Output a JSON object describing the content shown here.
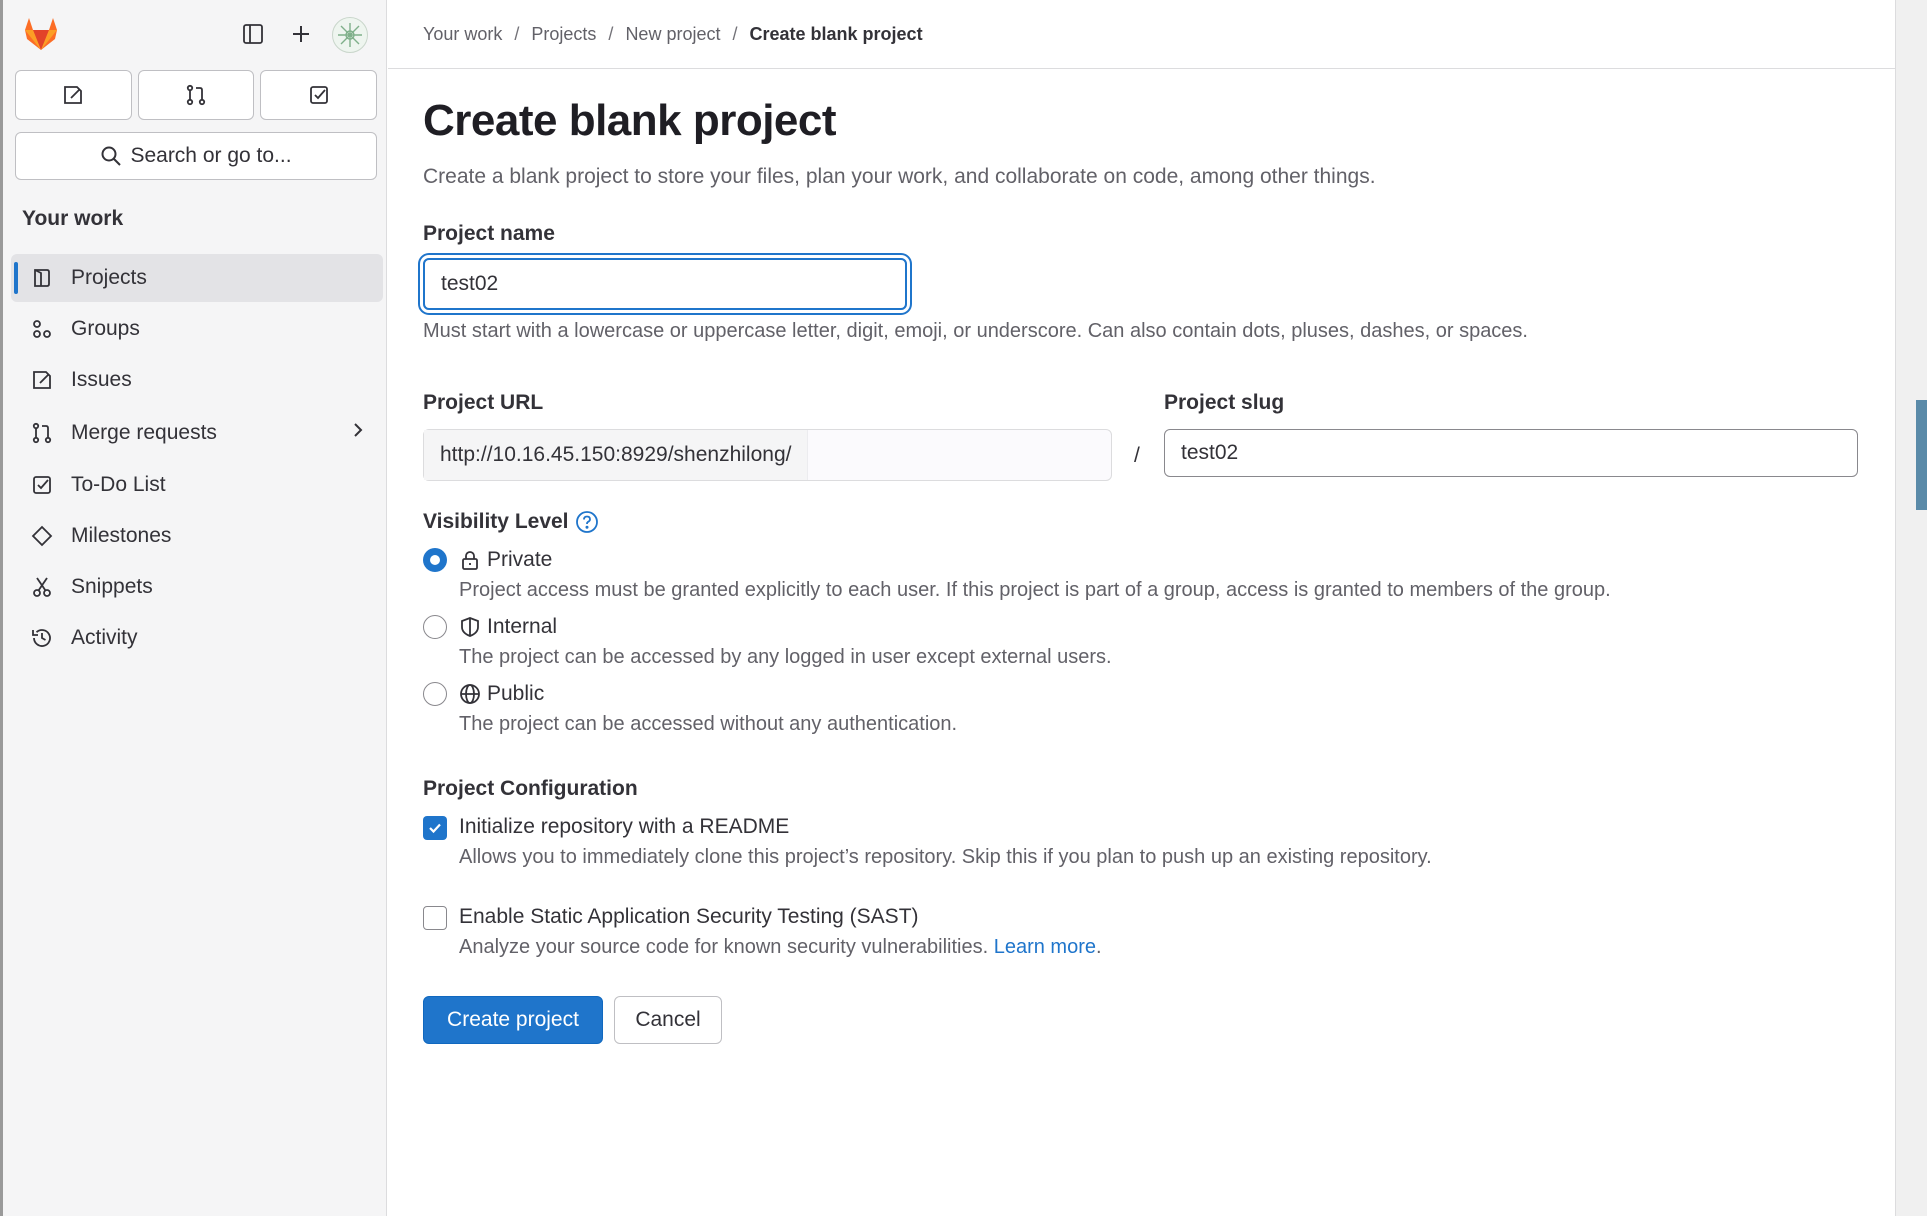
{
  "sidebar": {
    "search_label": "Search or go to...",
    "section_title": "Your work",
    "items": [
      {
        "label": "Projects",
        "icon": "project-icon"
      },
      {
        "label": "Groups",
        "icon": "group-icon"
      },
      {
        "label": "Issues",
        "icon": "issues-icon"
      },
      {
        "label": "Merge requests",
        "icon": "merge-request-icon"
      },
      {
        "label": "To-Do List",
        "icon": "todo-icon"
      },
      {
        "label": "Milestones",
        "icon": "milestone-icon"
      },
      {
        "label": "Snippets",
        "icon": "snippet-icon"
      },
      {
        "label": "Activity",
        "icon": "history-icon"
      }
    ]
  },
  "breadcrumb": [
    "Your work",
    "Projects",
    "New project",
    "Create blank project"
  ],
  "page": {
    "title": "Create blank project",
    "description": "Create a blank project to store your files, plan your work, and collaborate on code, among other things."
  },
  "form": {
    "project_name": {
      "label": "Project name",
      "value": "test02",
      "help": "Must start with a lowercase or uppercase letter, digit, emoji, or underscore. Can also contain dots, pluses, dashes, or spaces."
    },
    "project_url": {
      "label": "Project URL",
      "value": "http://10.16.45.150:8929/shenzhilong/"
    },
    "url_separator": "/",
    "project_slug": {
      "label": "Project slug",
      "value": "test02"
    },
    "visibility": {
      "label": "Visibility Level",
      "selected": "Private",
      "options": [
        {
          "title": "Private",
          "icon": "lock-icon",
          "description": "Project access must be granted explicitly to each user. If this project is part of a group, access is granted to members of the group."
        },
        {
          "title": "Internal",
          "icon": "shield-icon",
          "description": "The project can be accessed by any logged in user except external users."
        },
        {
          "title": "Public",
          "icon": "globe-icon",
          "description": "The project can be accessed without any authentication."
        }
      ]
    },
    "configuration": {
      "label": "Project Configuration",
      "readme": {
        "title": "Initialize repository with a README",
        "description": "Allows you to immediately clone this project’s repository. Skip this if you plan to push up an existing repository.",
        "checked": true
      },
      "sast": {
        "title": "Enable Static Application Security Testing (SAST)",
        "description": "Analyze your source code for known security vulnerabilities.",
        "link": "Learn more",
        "link_suffix": ".",
        "checked": false
      }
    },
    "create_button": "Create project",
    "cancel_button": "Cancel"
  },
  "colors": {
    "accent": "#1f75cb",
    "logo_orange": "#e24329",
    "logo_light": "#fc6d26",
    "logo_yellow": "#fca326"
  }
}
